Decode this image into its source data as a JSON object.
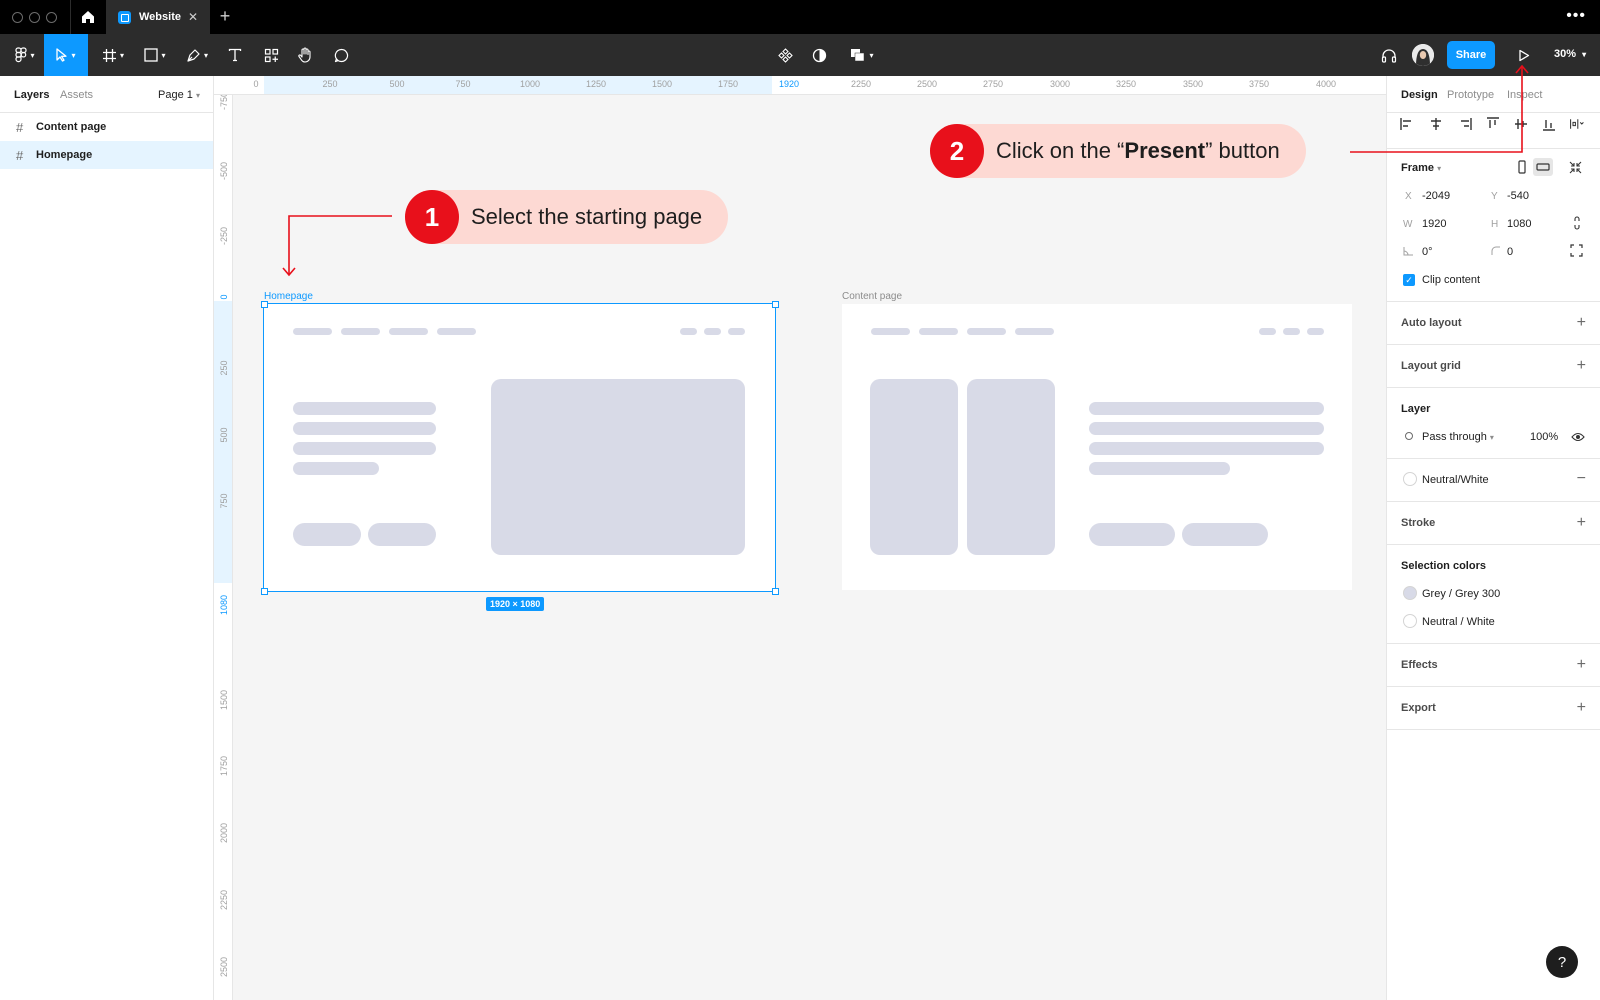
{
  "titlebar": {
    "tab_title": "Website",
    "tab_close": "✕",
    "tab_add": "+",
    "more": "•••"
  },
  "toolbar": {
    "share_label": "Share",
    "zoom_label": "30%"
  },
  "left_panel": {
    "tabs": [
      "Layers",
      "Assets"
    ],
    "page_selector": "Page 1",
    "layers": [
      {
        "name": "Content page",
        "selected": false
      },
      {
        "name": "Homepage",
        "selected": true
      }
    ]
  },
  "rulers": {
    "top_labels": [
      "0",
      "250",
      "500",
      "750",
      "1000",
      "1250",
      "1500",
      "1750",
      "1920",
      "2250",
      "2500",
      "2750",
      "3000",
      "3250",
      "3500",
      "3750",
      "4000"
    ],
    "top_highlight_label": "1920",
    "left_labels": [
      "-750",
      "-500",
      "-250",
      "0",
      "250",
      "500",
      "750",
      "1080",
      "1500",
      "1750",
      "2000",
      "2250",
      "2500"
    ],
    "left_highlight_labels": [
      "0",
      "1080"
    ]
  },
  "canvas": {
    "frame1_label": "Homepage",
    "frame2_label": "Content page",
    "dimension_badge": "1920 × 1080"
  },
  "callouts": {
    "step1": {
      "number": "1",
      "text": "Select the starting page"
    },
    "step2": {
      "number": "2",
      "text_before": "Click on the “",
      "text_bold": "Present",
      "text_after": "” button"
    }
  },
  "right_panel": {
    "tabs": [
      "Design",
      "Prototype",
      "Inspect"
    ],
    "frame_section": "Frame",
    "x_label": "X",
    "x_value": "-2049",
    "y_label": "Y",
    "y_value": "-540",
    "w_label": "W",
    "w_value": "1920",
    "h_label": "H",
    "h_value": "1080",
    "rotation_value": "0°",
    "radius_value": "0",
    "clip_content": "Clip content",
    "auto_layout": "Auto layout",
    "layout_grid": "Layout grid",
    "layer_section": "Layer",
    "blend_mode": "Pass through",
    "opacity": "100%",
    "fill_name": "Neutral/White",
    "stroke": "Stroke",
    "selection_colors": "Selection colors",
    "colors": [
      {
        "name": "Grey / Grey 300",
        "hex": "#d8dae7"
      },
      {
        "name": "Neutral / White",
        "hex": "#ffffff"
      }
    ],
    "effects": "Effects",
    "export": "Export"
  },
  "help": {
    "label": "?"
  },
  "colors": {
    "accent": "#0d99ff",
    "callout_red": "#e8101b",
    "callout_bg": "#fdd9d3",
    "placeholder": "#d8dae7"
  }
}
